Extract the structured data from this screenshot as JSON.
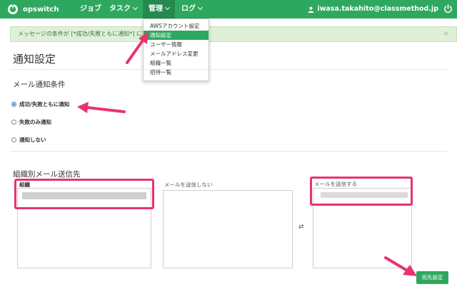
{
  "navbar": {
    "brand": "opswitch",
    "items": [
      {
        "label": "ジョブ",
        "has_caret": false
      },
      {
        "label": "タスク",
        "has_caret": true
      },
      {
        "label": "管理",
        "has_caret": true,
        "active": true
      },
      {
        "label": "ログ",
        "has_caret": true
      }
    ],
    "user_email": "iwasa.takahito@classmethod.jp"
  },
  "dropdown": {
    "items": [
      {
        "label": "AWSアカウント設定"
      },
      {
        "label": "通知設定",
        "active": true
      },
      {
        "label": "ユーザー情報"
      },
      {
        "label": "メールアドレス変更"
      },
      {
        "label": "組織一覧"
      },
      {
        "label": "招待一覧"
      }
    ]
  },
  "alert": {
    "text": "メッセージの条件が [*成功/失敗ともに通知*] に変更",
    "close": "×"
  },
  "page": {
    "title": "通知設定",
    "mail_section": {
      "title": "メール通知条件",
      "options": [
        {
          "label": "成功/失敗ともに通知",
          "checked": true
        },
        {
          "label": "失敗のみ通知",
          "checked": false
        },
        {
          "label": "通知しない",
          "checked": false
        }
      ]
    },
    "org_section": {
      "title": "組織別メール送信先",
      "col_org": "組織",
      "col_not_send": "メールを送信しない",
      "col_send": "メールを送信する",
      "swap_symbol": "⇄"
    },
    "save_label": "宛先設定"
  },
  "colors": {
    "brand_green": "#2fa85f",
    "highlight_pink": "#e8336f",
    "alert_bg": "#dff0d8"
  }
}
